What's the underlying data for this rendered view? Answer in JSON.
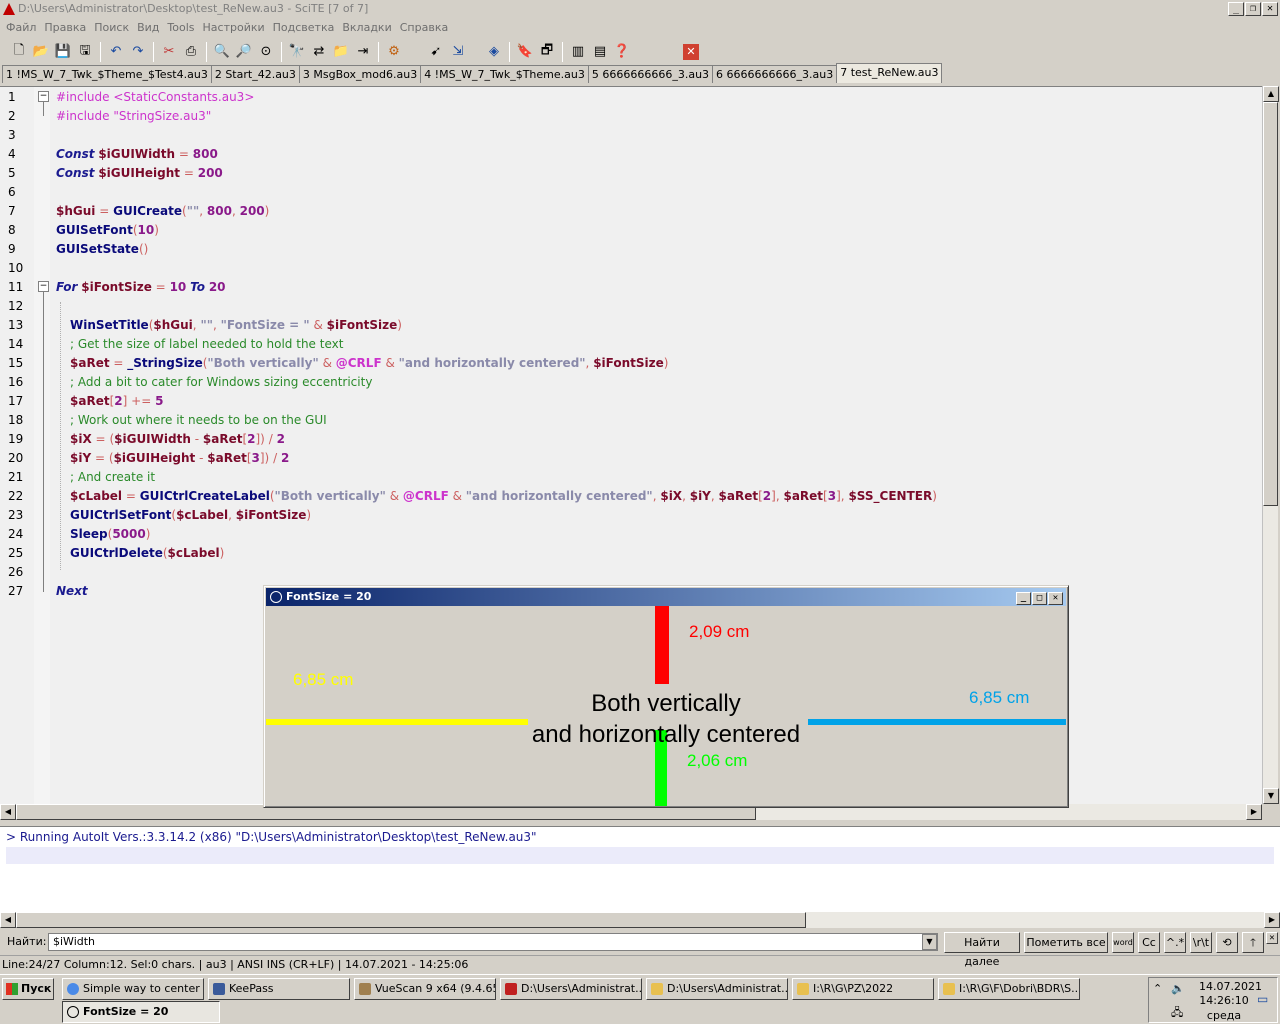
{
  "window": {
    "title": "D:\\Users\\Administrator\\Desktop\\test_ReNew.au3 - SciTE [7 of 7]"
  },
  "menu": [
    "Файл",
    "Правка",
    "Поиск",
    "Вид",
    "Tools",
    "Настройки",
    "Подсветка",
    "Вкладки",
    "Справка"
  ],
  "tabs": [
    {
      "label": "1 !MS_W_7_Twk_$Theme_$Test4.au3"
    },
    {
      "label": "2 Start_42.au3"
    },
    {
      "label": "3 MsgBox_mod6.au3"
    },
    {
      "label": "4 !MS_W_7_Twk_$Theme.au3"
    },
    {
      "label": "5 6666666666_3.au3"
    },
    {
      "label": "6 6666666666_3.au3"
    },
    {
      "label": "7 test_ReNew.au3"
    }
  ],
  "code": [
    {
      "n": "1",
      "t": "#include <StaticConstants.au3>"
    },
    {
      "n": "2",
      "t": "#include \"StringSize.au3\""
    },
    {
      "n": "3",
      "t": ""
    },
    {
      "n": "4",
      "t": "Const $iGUIWidth = 800"
    },
    {
      "n": "5",
      "t": "Const $iGUIHeight = 200"
    },
    {
      "n": "6",
      "t": ""
    },
    {
      "n": "7",
      "t": "$hGui = GUICreate(\"\", 800, 200)"
    },
    {
      "n": "8",
      "t": "GUISetFont(10)"
    },
    {
      "n": "9",
      "t": "GUISetState()"
    },
    {
      "n": "10",
      "t": ""
    },
    {
      "n": "11",
      "t": "For $iFontSize = 10 To 20"
    },
    {
      "n": "12",
      "t": ""
    },
    {
      "n": "13",
      "t": "WinSetTitle($hGui, \"\", \"FontSize = \" & $iFontSize)"
    },
    {
      "n": "14",
      "t": "; Get the size of label needed to hold the text"
    },
    {
      "n": "15",
      "t": "$aRet = _StringSize(\"Both vertically\" & @CRLF & \"and horizontally centered\", $iFontSize)"
    },
    {
      "n": "16",
      "t": "; Add a bit to cater for Windows sizing eccentricity"
    },
    {
      "n": "17",
      "t": "$aRet[2] += 5"
    },
    {
      "n": "18",
      "t": "; Work out where it needs to be on the GUI"
    },
    {
      "n": "19",
      "t": "$iX = ($iGUIWidth - $aRet[2]) / 2"
    },
    {
      "n": "20",
      "t": "$iY = ($iGUIHeight - $aRet[3]) / 2"
    },
    {
      "n": "21",
      "t": "; And create it"
    },
    {
      "n": "22",
      "t": "$cLabel = GUICtrlCreateLabel(\"Both vertically\" & @CRLF & \"and horizontally centered\", $iX, $iY, $aRet[2], $aRet[3], $SS_CENTER)"
    },
    {
      "n": "23",
      "t": "GUICtrlSetFont($cLabel, $iFontSize)"
    },
    {
      "n": "24",
      "t": "Sleep(5000)"
    },
    {
      "n": "25",
      "t": "GUICtrlDelete($cLabel)"
    },
    {
      "n": "26",
      "t": ""
    },
    {
      "n": "27",
      "t": "Next"
    }
  ],
  "gui": {
    "title": "FontSize = 20",
    "line1": "Both vertically",
    "line2": "and horizontally centered",
    "m_top": "2,09 cm",
    "m_left": "6,85 cm",
    "m_right": "6,85 cm",
    "m_bottom": "2,06 cm"
  },
  "output": {
    "line1": "> Running AutoIt Vers.:3.3.14.2 (x86) \"D:\\Users\\Administrator\\Desktop\\test_ReNew.au3\""
  },
  "find": {
    "label": "Найти:",
    "value": "$iWidth",
    "next_label": "Найти далее",
    "mark_label": "Пометить все",
    "opt_word": "word",
    "opt_case": "Cc",
    "opt_regex": "^.*",
    "opt_esc": "\\r\\t"
  },
  "status": {
    "text": "Line:24/27 Column:12. Sel:0 chars. | au3 | ANSI INS (CR+LF) | 14.07.2021 - 14:25:06"
  },
  "taskbar": {
    "start": "Пуск",
    "items": [
      {
        "label": "Simple way to center ..."
      },
      {
        "label": "KeePass"
      },
      {
        "label": "VueScan 9 x64 (9.4.65)"
      },
      {
        "label": "D:\\Users\\Administrat..."
      },
      {
        "label": "D:\\Users\\Administrat..."
      },
      {
        "label": "I:\\R\\G\\PZ\\2022"
      },
      {
        "label": "I:\\R\\G\\F\\Dobri\\BDR\\S..."
      },
      {
        "label": "FontSize = 20"
      }
    ],
    "date": "14.07.2021",
    "time": "14:26:10",
    "day": "среда"
  },
  "colors": {
    "red": "#ff0000",
    "yellow": "#ffff00",
    "blue": "#00a2e8",
    "green": "#00ff00"
  }
}
